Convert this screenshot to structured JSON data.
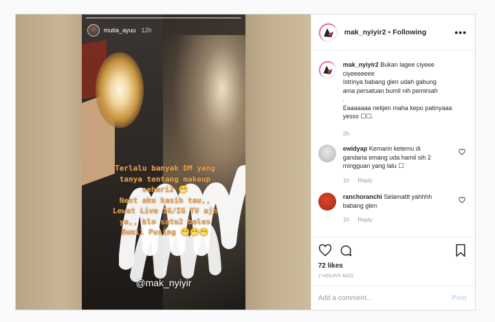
{
  "story": {
    "username": "mutia_ayuu",
    "time": "12h",
    "text_lines": [
      "Terlalu banyak DM yang",
      "tanya tentang makeup",
      "sehari2 😁",
      "Next aku kasih tau,,",
      "Lewat Live IG/IG TV ajh",
      "ya,, klo satu2 bales",
      "Bumil Pusing 😁😁😁"
    ],
    "watermark": "@mak_nyiyir"
  },
  "post": {
    "username": "mak_nyiyir2",
    "separator": "•",
    "follow_status": "Following",
    "more_icon": "•••"
  },
  "comments": [
    {
      "username": "mak_nyiyir2",
      "lines": [
        "Bukan lagee ciyeee",
        "ciyeeeeeee",
        "Istrinya babang glen udah gabung",
        "ama persatuan bumil nih pemirsah",
        ".",
        "Eaaaaaaa netijen maha kepo patinyaaa",
        "yesss ☐☐."
      ],
      "time": "2h",
      "reply": ""
    },
    {
      "username": "ewidyap",
      "lines": [
        "Kemarin ketemu di",
        "gandaria emang uda hamil sih 2",
        "mingguan yang lalu ☐"
      ],
      "time": "1h",
      "reply": "Reply"
    },
    {
      "username": "ranchoranchi",
      "lines": [
        "Selamattt yahhhh",
        "babang glen"
      ],
      "time": "1h",
      "reply": "Reply"
    }
  ],
  "actions": {
    "likes": "72 likes",
    "date": "2 HOURS AGO"
  },
  "add_comment": {
    "placeholder": "Add a comment...",
    "post_label": "Post"
  },
  "colors": {
    "story_text": "#e0a455",
    "link_blue": "#b3dbff",
    "muted": "#999999"
  }
}
